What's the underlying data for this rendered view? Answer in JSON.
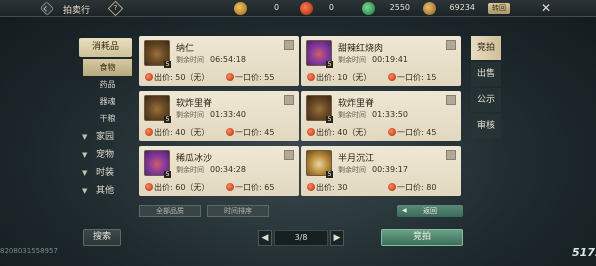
{
  "header": {
    "title": "拍卖行",
    "help": "?",
    "recharge": "转回",
    "currencies": [
      {
        "name": "gold-ingot-icon",
        "value": "0"
      },
      {
        "name": "red-coin-icon",
        "value": "0"
      },
      {
        "name": "jade-icon",
        "value": "2550"
      },
      {
        "name": "silver-icon",
        "value": "69234"
      }
    ]
  },
  "categories": {
    "main": "消耗品",
    "subs": [
      "食物",
      "药品",
      "器魂",
      "干粮"
    ],
    "groups": [
      "家园",
      "宠物",
      "时装",
      "其他"
    ]
  },
  "items": [
    {
      "name": "纳仁",
      "remaining_label": "剩余时间",
      "remaining": "06:54:18",
      "bid": "出价: 50（无）",
      "buy": "一口价: 55",
      "level": "5"
    },
    {
      "name": "甜辣红烧肉",
      "remaining_label": "剩余时间",
      "remaining": "00:19:41",
      "bid": "出价: 10（无）",
      "buy": "一口价: 15",
      "level": "5"
    },
    {
      "name": "软炸里脊",
      "remaining_label": "剩余时间",
      "remaining": "01:33:40",
      "bid": "出价: 40（无）",
      "buy": "一口价: 45",
      "level": "5"
    },
    {
      "name": "软炸里脊",
      "remaining_label": "剩余时间",
      "remaining": "01:33:50",
      "bid": "出价: 40（无）",
      "buy": "一口价: 45",
      "level": "5"
    },
    {
      "name": "稀瓜冰沙",
      "remaining_label": "剩余时间",
      "remaining": "00:34:28",
      "bid": "出价: 60（无）",
      "buy": "一口价: 65",
      "level": "5"
    },
    {
      "name": "半月沉江",
      "remaining_label": "剩余时间",
      "remaining": "00:39:17",
      "bid": "出价: 30",
      "buy": "一口价: 80",
      "level": "5"
    }
  ],
  "tabs": [
    "竞拍",
    "出售",
    "公示",
    "审核"
  ],
  "filters": [
    "全部品质",
    "时间排序"
  ],
  "return_label": "返回",
  "footer": {
    "search": "搜索",
    "page": "3/8",
    "prev": "◀",
    "next": "▶",
    "bid": "竞拍",
    "uid": "8208031558957",
    "logo": "5173"
  }
}
